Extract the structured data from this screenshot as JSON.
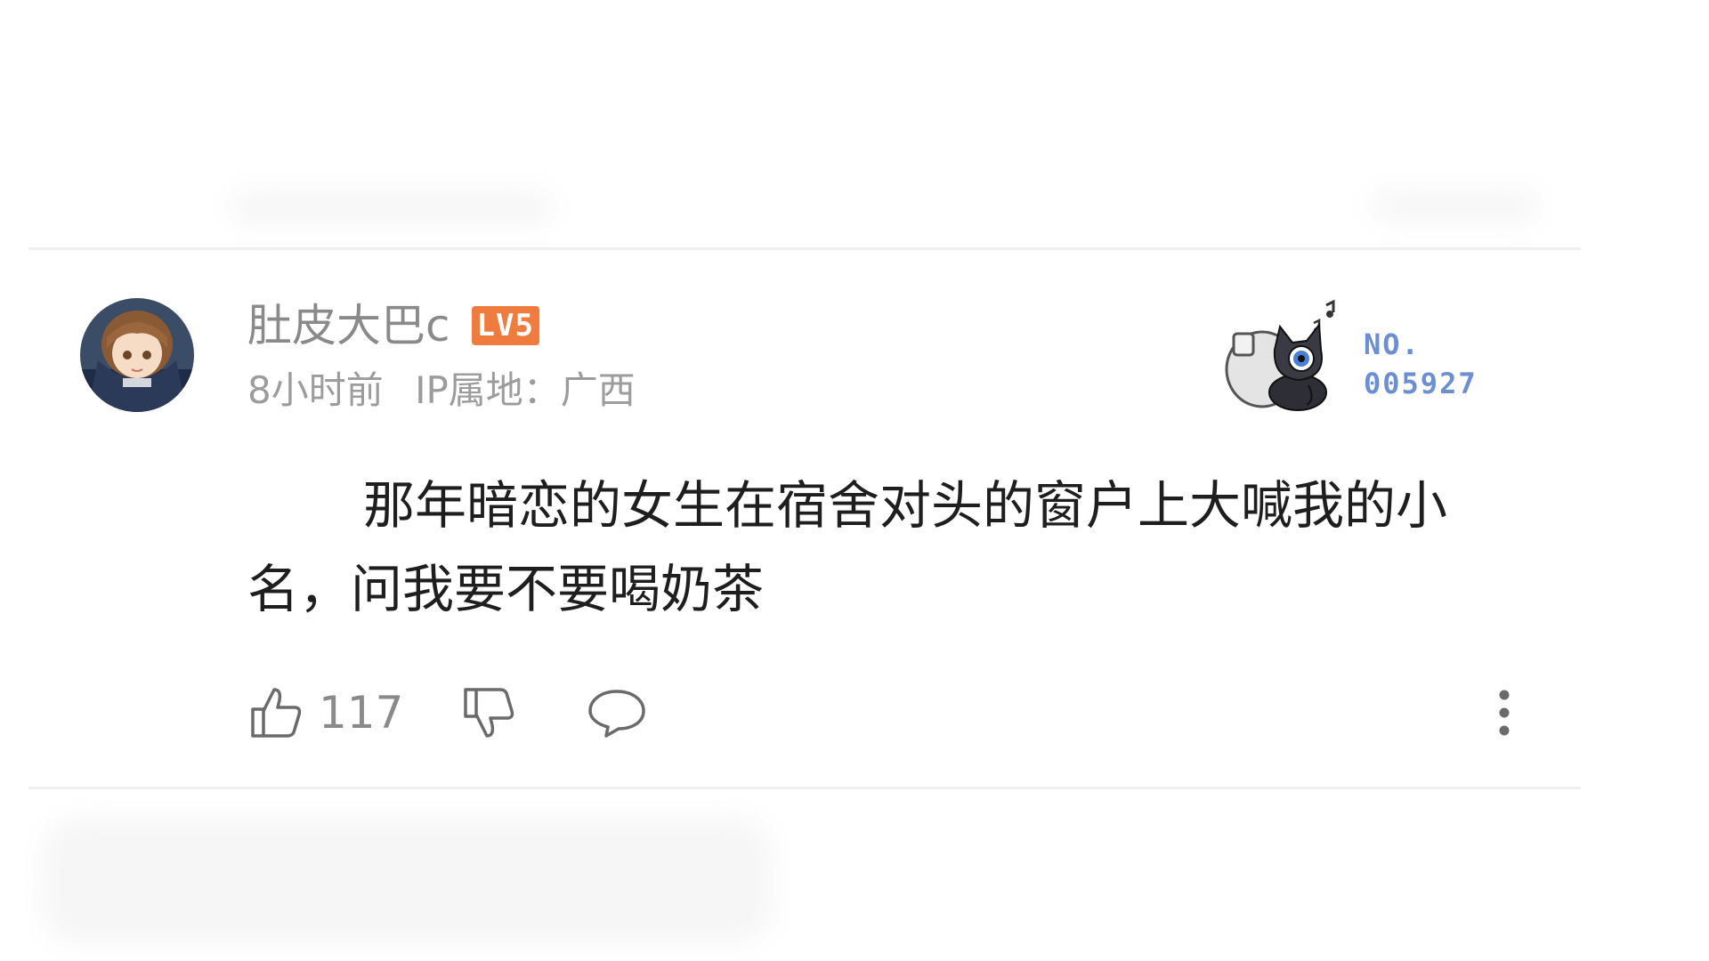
{
  "comment": {
    "username": "肚皮大巴c",
    "level": "LV5",
    "time": "8小时前",
    "ip_location": "IP属地：广西",
    "fan_badge": {
      "label": "NO.",
      "number": "005927"
    },
    "content": "那年暗恋的女生在宿舍对头的窗户上大喊我的小名，问我要不要喝奶茶",
    "likes": "117"
  },
  "colors": {
    "level_badge": "#f07b3f",
    "fan_number": "#6b8fd0",
    "secondary_text": "#8a8a8a",
    "primary_text": "#1e1e1e"
  },
  "icons": {
    "like": "thumbs-up-icon",
    "dislike": "thumbs-down-icon",
    "reply": "speech-bubble-icon",
    "more": "vertical-ellipsis-icon",
    "fan_badge": "cat-mascot-icon"
  }
}
